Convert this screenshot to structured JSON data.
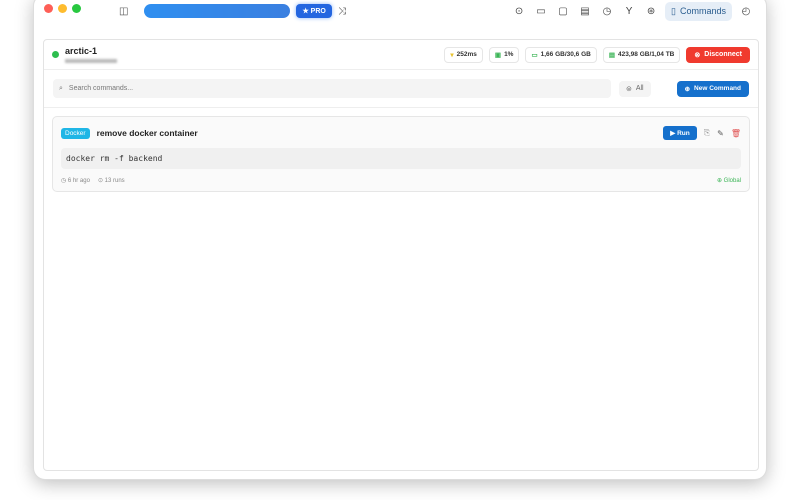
{
  "toolbar": {
    "pro_label": "★ PRO",
    "commands_tab": "Commands"
  },
  "server": {
    "name": "arctic-1",
    "latency": "252ms",
    "cpu": "1%",
    "memory": "1,66 GB/30,6 GB",
    "disk": "423,98 GB/1,04 TB",
    "disconnect_label": "Disconnect"
  },
  "search": {
    "placeholder": "Search commands...",
    "filter_label": "All",
    "new_command_label": "New Command"
  },
  "commands": [
    {
      "tag": "Docker",
      "title": "remove docker container",
      "command": "docker rm -f backend",
      "run_label": "▶ Run",
      "time": "6 hr ago",
      "runs": "13 runs",
      "scope": "Global"
    }
  ],
  "colors": {
    "accent": "#1570cc",
    "danger": "#f03a2e",
    "online": "#2dbd4e",
    "tag": "#1fb6e6"
  }
}
